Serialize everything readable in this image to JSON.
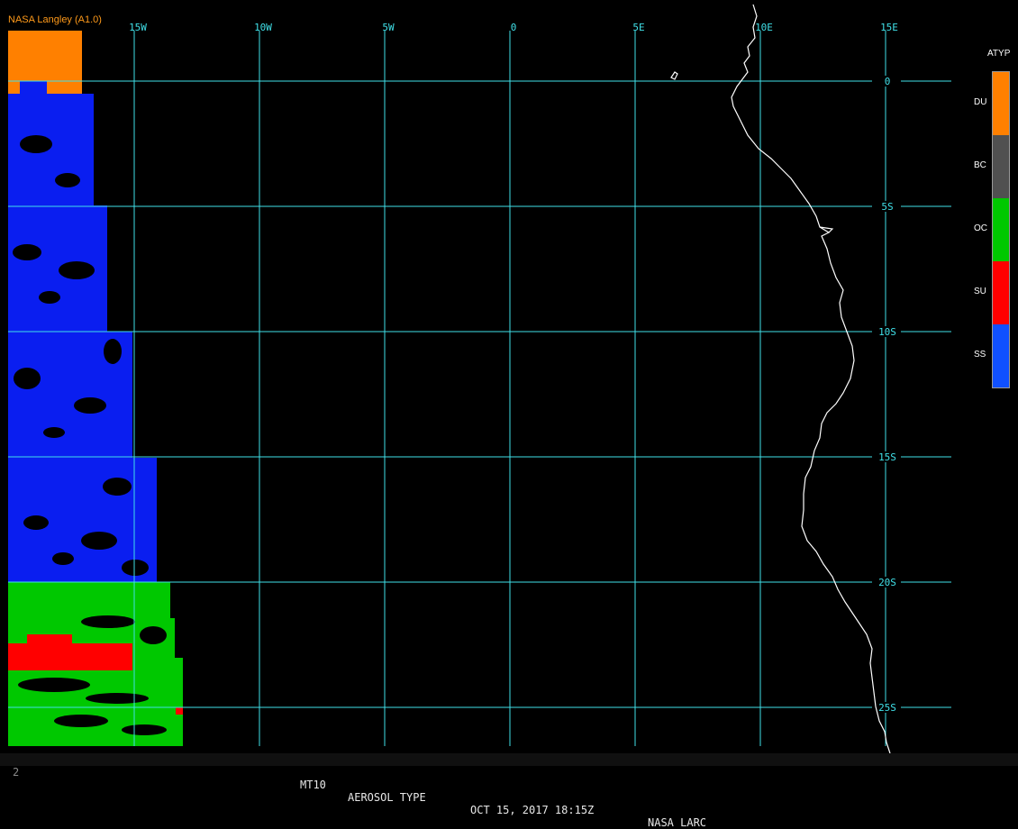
{
  "credit": "NASA Langley (A1.0)",
  "status_bar": {
    "left_glyph": "2",
    "product": "MT10",
    "title": "AEROSOL TYPE",
    "datetime": "OCT 15, 2017 18:15Z",
    "source": "NASA LARC"
  },
  "grid": {
    "lon_labels": [
      "15W",
      "10W",
      "5W",
      "0",
      "5E",
      "10E",
      "15E"
    ],
    "lat_labels": [
      "0",
      "5S",
      "10S",
      "15S",
      "20S",
      "25S"
    ]
  },
  "legend": {
    "title": "ATYP",
    "categories": [
      {
        "code": "DU",
        "color": "#ff8000"
      },
      {
        "code": "BC",
        "color": "#505050"
      },
      {
        "code": "OC",
        "color": "#00c800"
      },
      {
        "code": "SU",
        "color": "#ff0000"
      },
      {
        "code": "SS",
        "color": "#1050ff"
      }
    ]
  },
  "colors": {
    "grid": "#40e0e8",
    "coast": "#ffffff",
    "background": "#000000"
  }
}
